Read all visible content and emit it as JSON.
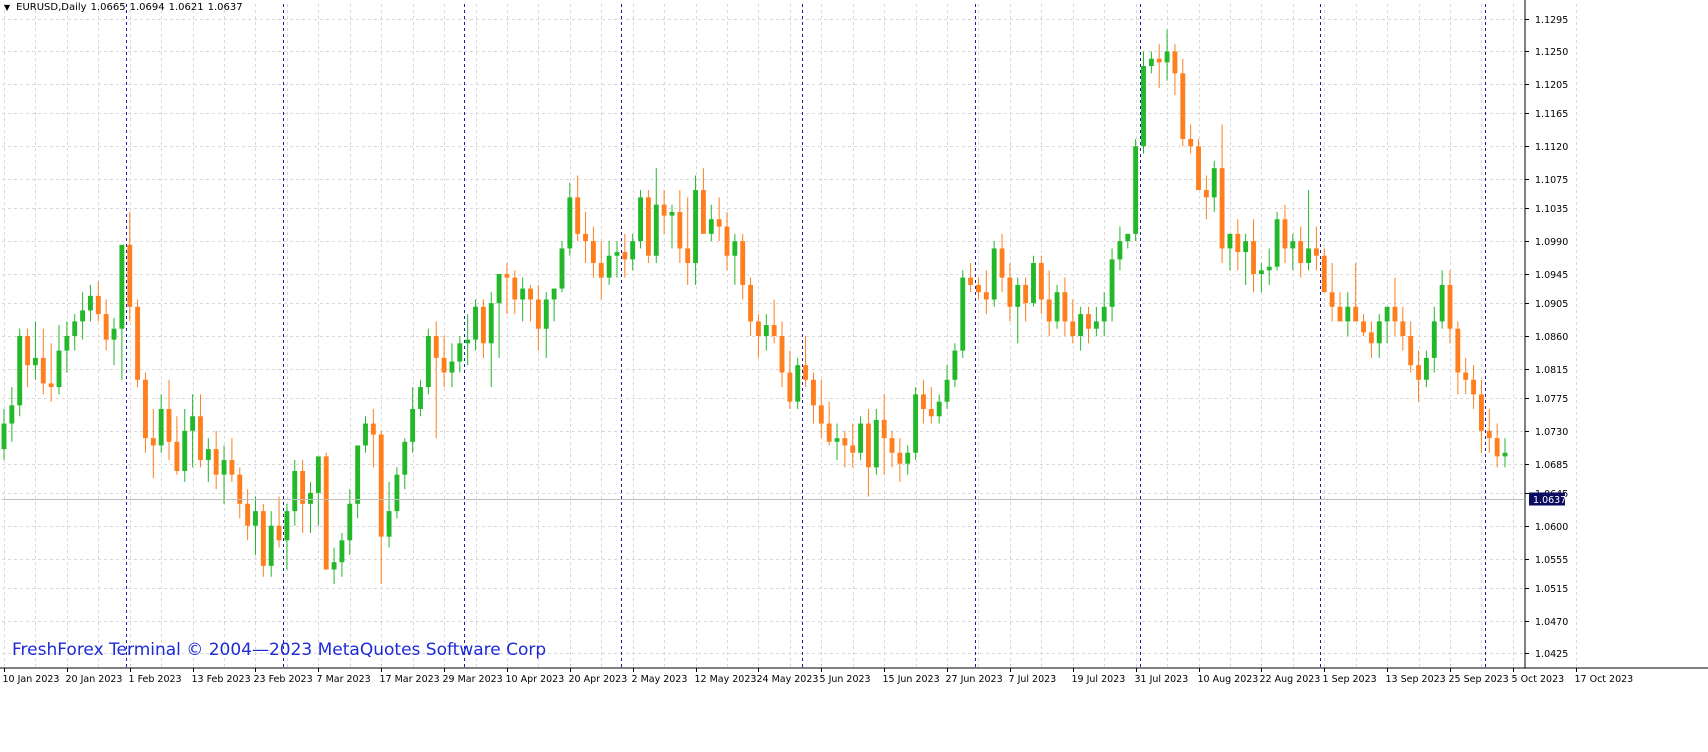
{
  "symbol_info": {
    "symbol": "EURUSD,Daily",
    "open": "1.0665",
    "high": "1.0694",
    "low": "1.0621",
    "close": "1.0637"
  },
  "watermark": "FreshForex Terminal © 2004—2023 MetaQuotes Software Corp",
  "colors": {
    "bull": "#22b82a",
    "bear": "#ff7f1e",
    "wick_bull": "#22b82a",
    "wick_bear": "#ff7f1e",
    "grid": "#d9d9d9",
    "period_sep": "#1a1aa6",
    "axis": "#000000",
    "price_tag_bg": "#0b0b60",
    "price_tag_fg": "#ffffff",
    "watermark": "#1e2ad6"
  },
  "chart_data": {
    "type": "candlestick",
    "title": "",
    "ylim": [
      1.0405,
      1.1315
    ],
    "y_ticks": [
      "1.1295",
      "1.1250",
      "1.1205",
      "1.1165",
      "1.1120",
      "1.1075",
      "1.1035",
      "1.0990",
      "1.0945",
      "1.0905",
      "1.0860",
      "1.0815",
      "1.0775",
      "1.0730",
      "1.0685",
      "1.0645",
      "1.0600",
      "1.0555",
      "1.0515",
      "1.0470",
      "1.0425"
    ],
    "current_price": "1.0637",
    "x_labels": [
      "10 Jan 2023",
      "20 Jan 2023",
      "1 Feb 2023",
      "13 Feb 2023",
      "23 Feb 2023",
      "7 Mar 2023",
      "17 Mar 2023",
      "29 Mar 2023",
      "10 Apr 2023",
      "20 Apr 2023",
      "2 May 2023",
      "12 May 2023",
      "24 May 2023",
      "5 Jun 2023",
      "15 Jun 2023",
      "27 Jun 2023",
      "7 Jul 2023",
      "19 Jul 2023",
      "31 Jul 2023",
      "10 Aug 2023",
      "22 Aug 2023",
      "1 Sep 2023",
      "13 Sep 2023",
      "25 Sep 2023",
      "5 Oct 2023",
      "17 Oct 2023"
    ],
    "x_label_index": [
      0,
      8,
      16,
      24,
      32,
      40,
      48,
      56,
      64,
      72,
      80,
      88,
      96,
      104,
      112,
      120,
      128,
      136,
      144,
      152,
      160,
      168,
      176,
      184,
      192,
      200
    ],
    "period_separators": [
      16,
      36,
      59,
      79,
      102,
      124,
      145,
      168,
      189
    ],
    "grid": true,
    "candles": [
      [
        1.0705,
        1.076,
        1.069,
        1.074
      ],
      [
        1.074,
        1.079,
        1.0715,
        1.0765
      ],
      [
        1.0765,
        1.087,
        1.075,
        1.086
      ],
      [
        1.086,
        1.087,
        1.079,
        1.082
      ],
      [
        1.082,
        1.088,
        1.08,
        1.083
      ],
      [
        1.083,
        1.087,
        1.078,
        1.0795
      ],
      [
        1.0795,
        1.085,
        1.077,
        1.079
      ],
      [
        1.079,
        1.0875,
        1.078,
        1.084
      ],
      [
        1.084,
        1.088,
        1.081,
        1.086
      ],
      [
        1.086,
        1.089,
        1.084,
        1.088
      ],
      [
        1.088,
        1.092,
        1.0855,
        1.0895
      ],
      [
        1.0895,
        1.093,
        1.088,
        1.0915
      ],
      [
        1.0915,
        1.0935,
        1.088,
        1.089
      ],
      [
        1.089,
        1.091,
        1.084,
        1.0855
      ],
      [
        1.0855,
        1.0885,
        1.082,
        1.087
      ],
      [
        1.087,
        1.095,
        1.08,
        1.0985
      ],
      [
        1.0985,
        1.103,
        1.088,
        1.09
      ],
      [
        1.09,
        1.091,
        1.079,
        1.08
      ],
      [
        1.08,
        1.081,
        1.07,
        1.072
      ],
      [
        1.072,
        1.076,
        1.0665,
        1.071
      ],
      [
        1.071,
        1.078,
        1.07,
        1.076
      ],
      [
        1.076,
        1.08,
        1.069,
        1.0715
      ],
      [
        1.0715,
        1.075,
        1.067,
        1.0675
      ],
      [
        1.0675,
        1.076,
        1.066,
        1.073
      ],
      [
        1.073,
        1.078,
        1.068,
        1.075
      ],
      [
        1.075,
        1.078,
        1.068,
        1.069
      ],
      [
        1.069,
        1.072,
        1.066,
        1.0705
      ],
      [
        1.0705,
        1.073,
        1.065,
        1.067
      ],
      [
        1.067,
        1.071,
        1.063,
        1.069
      ],
      [
        1.069,
        1.072,
        1.066,
        1.067
      ],
      [
        1.067,
        1.068,
        1.061,
        1.063
      ],
      [
        1.063,
        1.065,
        1.058,
        1.06
      ],
      [
        1.06,
        1.064,
        1.056,
        1.062
      ],
      [
        1.062,
        1.063,
        1.053,
        1.0545
      ],
      [
        1.0545,
        1.062,
        1.053,
        1.06
      ],
      [
        1.06,
        1.064,
        1.057,
        1.058
      ],
      [
        1.058,
        1.063,
        1.054,
        1.062
      ],
      [
        1.062,
        1.069,
        1.06,
        1.0675
      ],
      [
        1.0675,
        1.069,
        1.059,
        1.063
      ],
      [
        1.063,
        1.066,
        1.059,
        1.0645
      ],
      [
        1.0645,
        1.067,
        1.06,
        1.0695
      ],
      [
        1.0695,
        1.07,
        1.059,
        1.054
      ],
      [
        1.054,
        1.057,
        1.052,
        1.055
      ],
      [
        1.055,
        1.059,
        1.053,
        1.058
      ],
      [
        1.058,
        1.065,
        1.056,
        1.063
      ],
      [
        1.063,
        1.069,
        1.061,
        1.071
      ],
      [
        1.071,
        1.075,
        1.07,
        1.074
      ],
      [
        1.074,
        1.076,
        1.068,
        1.0725
      ],
      [
        1.0725,
        1.073,
        1.052,
        1.0585
      ],
      [
        1.0585,
        1.066,
        1.057,
        1.062
      ],
      [
        1.062,
        1.068,
        1.061,
        1.067
      ],
      [
        1.067,
        1.072,
        1.065,
        1.0715
      ],
      [
        1.0715,
        1.079,
        1.07,
        1.076
      ],
      [
        1.076,
        1.08,
        1.075,
        1.079
      ],
      [
        1.079,
        1.087,
        1.078,
        1.086
      ],
      [
        1.086,
        1.088,
        1.072,
        1.083
      ],
      [
        1.083,
        1.086,
        1.079,
        1.081
      ],
      [
        1.081,
        1.085,
        1.079,
        1.0825
      ],
      [
        1.0825,
        1.086,
        1.081,
        1.085
      ],
      [
        1.085,
        1.089,
        1.082,
        1.0855
      ],
      [
        1.0855,
        1.091,
        1.084,
        1.09
      ],
      [
        1.09,
        1.091,
        1.083,
        1.085
      ],
      [
        1.085,
        1.092,
        1.079,
        1.0905
      ],
      [
        1.0905,
        1.094,
        1.083,
        1.0945
      ],
      [
        1.0945,
        1.096,
        1.089,
        1.094
      ],
      [
        1.094,
        1.095,
        1.089,
        1.091
      ],
      [
        1.091,
        1.094,
        1.088,
        1.0925
      ],
      [
        1.0925,
        1.093,
        1.088,
        1.091
      ],
      [
        1.091,
        1.093,
        1.084,
        1.087
      ],
      [
        1.087,
        1.092,
        1.083,
        1.091
      ],
      [
        1.091,
        1.092,
        1.088,
        1.0925
      ],
      [
        1.0925,
        1.099,
        1.092,
        1.098
      ],
      [
        1.098,
        1.107,
        1.097,
        1.105
      ],
      [
        1.105,
        1.108,
        1.099,
        1.1
      ],
      [
        1.1,
        1.103,
        1.096,
        1.099
      ],
      [
        1.099,
        1.101,
        1.094,
        1.096
      ],
      [
        1.096,
        1.099,
        1.091,
        1.094
      ],
      [
        1.094,
        1.099,
        1.093,
        1.097
      ],
      [
        1.097,
        1.099,
        1.094,
        1.0975
      ],
      [
        1.0975,
        1.1,
        1.094,
        1.0965
      ],
      [
        1.0965,
        1.1,
        1.095,
        1.099
      ],
      [
        1.099,
        1.106,
        1.098,
        1.105
      ],
      [
        1.105,
        1.106,
        1.096,
        1.097
      ],
      [
        1.097,
        1.109,
        1.096,
        1.104
      ],
      [
        1.104,
        1.106,
        1.1,
        1.1025
      ],
      [
        1.1025,
        1.104,
        1.098,
        1.103
      ],
      [
        1.103,
        1.106,
        1.096,
        1.098
      ],
      [
        1.098,
        1.105,
        1.093,
        1.096
      ],
      [
        1.096,
        1.108,
        1.093,
        1.106
      ],
      [
        1.106,
        1.109,
        1.1,
        1.1
      ],
      [
        1.1,
        1.104,
        1.099,
        1.102
      ],
      [
        1.102,
        1.105,
        1.099,
        1.101
      ],
      [
        1.101,
        1.103,
        1.095,
        1.097
      ],
      [
        1.097,
        1.1,
        1.093,
        1.099
      ],
      [
        1.099,
        1.1,
        1.091,
        1.093
      ],
      [
        1.093,
        1.094,
        1.086,
        1.088
      ],
      [
        1.088,
        1.089,
        1.083,
        1.086
      ],
      [
        1.086,
        1.089,
        1.084,
        1.0875
      ],
      [
        1.0875,
        1.091,
        1.085,
        1.086
      ],
      [
        1.086,
        1.088,
        1.079,
        1.081
      ],
      [
        1.081,
        1.084,
        1.076,
        1.077
      ],
      [
        1.077,
        1.083,
        1.076,
        1.082
      ],
      [
        1.082,
        1.086,
        1.079,
        1.08
      ],
      [
        1.08,
        1.081,
        1.074,
        1.0765
      ],
      [
        1.0765,
        1.08,
        1.072,
        1.074
      ],
      [
        1.074,
        1.077,
        1.071,
        1.0715
      ],
      [
        1.0715,
        1.074,
        1.069,
        1.072
      ],
      [
        1.072,
        1.073,
        1.068,
        1.071
      ],
      [
        1.071,
        1.074,
        1.068,
        1.07
      ],
      [
        1.07,
        1.075,
        1.069,
        1.074
      ],
      [
        1.074,
        1.076,
        1.064,
        1.068
      ],
      [
        1.068,
        1.076,
        1.067,
        1.0745
      ],
      [
        1.0745,
        1.078,
        1.067,
        1.072
      ],
      [
        1.072,
        1.073,
        1.068,
        1.07
      ],
      [
        1.07,
        1.072,
        1.066,
        1.0685
      ],
      [
        1.0685,
        1.071,
        1.067,
        1.07
      ],
      [
        1.07,
        1.079,
        1.069,
        1.078
      ],
      [
        1.078,
        1.08,
        1.074,
        1.076
      ],
      [
        1.076,
        1.079,
        1.074,
        1.075
      ],
      [
        1.075,
        1.078,
        1.074,
        1.077
      ],
      [
        1.077,
        1.082,
        1.076,
        1.08
      ],
      [
        1.08,
        1.085,
        1.079,
        1.084
      ],
      [
        1.084,
        1.095,
        1.083,
        1.094
      ],
      [
        1.094,
        1.096,
        1.092,
        1.093
      ],
      [
        1.093,
        1.094,
        1.091,
        1.092
      ],
      [
        1.092,
        1.095,
        1.089,
        1.091
      ],
      [
        1.091,
        1.099,
        1.09,
        1.098
      ],
      [
        1.098,
        1.1,
        1.092,
        1.094
      ],
      [
        1.094,
        1.096,
        1.088,
        1.09
      ],
      [
        1.09,
        1.094,
        1.085,
        1.093
      ],
      [
        1.093,
        1.094,
        1.088,
        1.0905
      ],
      [
        1.0905,
        1.097,
        1.09,
        1.096
      ],
      [
        1.096,
        1.097,
        1.089,
        1.091
      ],
      [
        1.091,
        1.095,
        1.086,
        1.088
      ],
      [
        1.088,
        1.093,
        1.087,
        1.092
      ],
      [
        1.092,
        1.094,
        1.086,
        1.088
      ],
      [
        1.088,
        1.091,
        1.085,
        1.086
      ],
      [
        1.086,
        1.09,
        1.084,
        1.089
      ],
      [
        1.089,
        1.09,
        1.085,
        1.087
      ],
      [
        1.087,
        1.09,
        1.086,
        1.088
      ],
      [
        1.088,
        1.092,
        1.086,
        1.09
      ],
      [
        1.09,
        1.098,
        1.088,
        1.0965
      ],
      [
        1.0965,
        1.101,
        1.095,
        1.099
      ],
      [
        1.099,
        1.1,
        1.098,
        1.1
      ],
      [
        1.1,
        1.113,
        1.099,
        1.112
      ],
      [
        1.112,
        1.125,
        1.111,
        1.123
      ],
      [
        1.123,
        1.125,
        1.122,
        1.124
      ],
      [
        1.124,
        1.126,
        1.12,
        1.1235
      ],
      [
        1.1235,
        1.128,
        1.121,
        1.125
      ],
      [
        1.125,
        1.126,
        1.119,
        1.122
      ],
      [
        1.122,
        1.124,
        1.112,
        1.113
      ],
      [
        1.113,
        1.115,
        1.111,
        1.112
      ],
      [
        1.112,
        1.113,
        1.106,
        1.106
      ],
      [
        1.106,
        1.108,
        1.102,
        1.105
      ],
      [
        1.105,
        1.11,
        1.103,
        1.109
      ],
      [
        1.109,
        1.115,
        1.096,
        1.098
      ],
      [
        1.098,
        1.1,
        1.095,
        1.1
      ],
      [
        1.1,
        1.102,
        1.095,
        1.0975
      ],
      [
        1.0975,
        1.1,
        1.093,
        1.099
      ],
      [
        1.099,
        1.102,
        1.092,
        1.0945
      ],
      [
        1.0945,
        1.096,
        1.092,
        1.095
      ],
      [
        1.095,
        1.098,
        1.093,
        1.0955
      ],
      [
        1.0955,
        1.103,
        1.095,
        1.102
      ],
      [
        1.102,
        1.104,
        1.096,
        1.098
      ],
      [
        1.098,
        1.1,
        1.095,
        1.099
      ],
      [
        1.099,
        1.101,
        1.094,
        1.096
      ],
      [
        1.096,
        1.106,
        1.095,
        1.098
      ],
      [
        1.098,
        1.101,
        1.095,
        1.097
      ],
      [
        1.097,
        1.098,
        1.092,
        1.092
      ],
      [
        1.092,
        1.096,
        1.088,
        1.09
      ],
      [
        1.09,
        1.092,
        1.088,
        1.088
      ],
      [
        1.088,
        1.092,
        1.086,
        1.09
      ],
      [
        1.09,
        1.096,
        1.088,
        1.088
      ],
      [
        1.088,
        1.089,
        1.086,
        1.0865
      ],
      [
        1.0865,
        1.088,
        1.083,
        1.085
      ],
      [
        1.085,
        1.089,
        1.083,
        1.088
      ],
      [
        1.088,
        1.09,
        1.085,
        1.09
      ],
      [
        1.09,
        1.094,
        1.086,
        1.088
      ],
      [
        1.088,
        1.09,
        1.084,
        1.086
      ],
      [
        1.086,
        1.088,
        1.081,
        1.082
      ],
      [
        1.082,
        1.084,
        1.077,
        1.08
      ],
      [
        1.08,
        1.084,
        1.079,
        1.083
      ],
      [
        1.083,
        1.09,
        1.081,
        1.088
      ],
      [
        1.088,
        1.095,
        1.087,
        1.093
      ],
      [
        1.093,
        1.095,
        1.085,
        1.087
      ],
      [
        1.087,
        1.088,
        1.078,
        1.081
      ],
      [
        1.081,
        1.083,
        1.078,
        1.08
      ],
      [
        1.08,
        1.082,
        1.076,
        1.078
      ],
      [
        1.078,
        1.08,
        1.07,
        1.073
      ],
      [
        1.073,
        1.076,
        1.07,
        1.072
      ],
      [
        1.072,
        1.074,
        1.068,
        1.0695
      ],
      [
        1.0695,
        1.072,
        1.068,
        1.07
      ]
    ]
  }
}
